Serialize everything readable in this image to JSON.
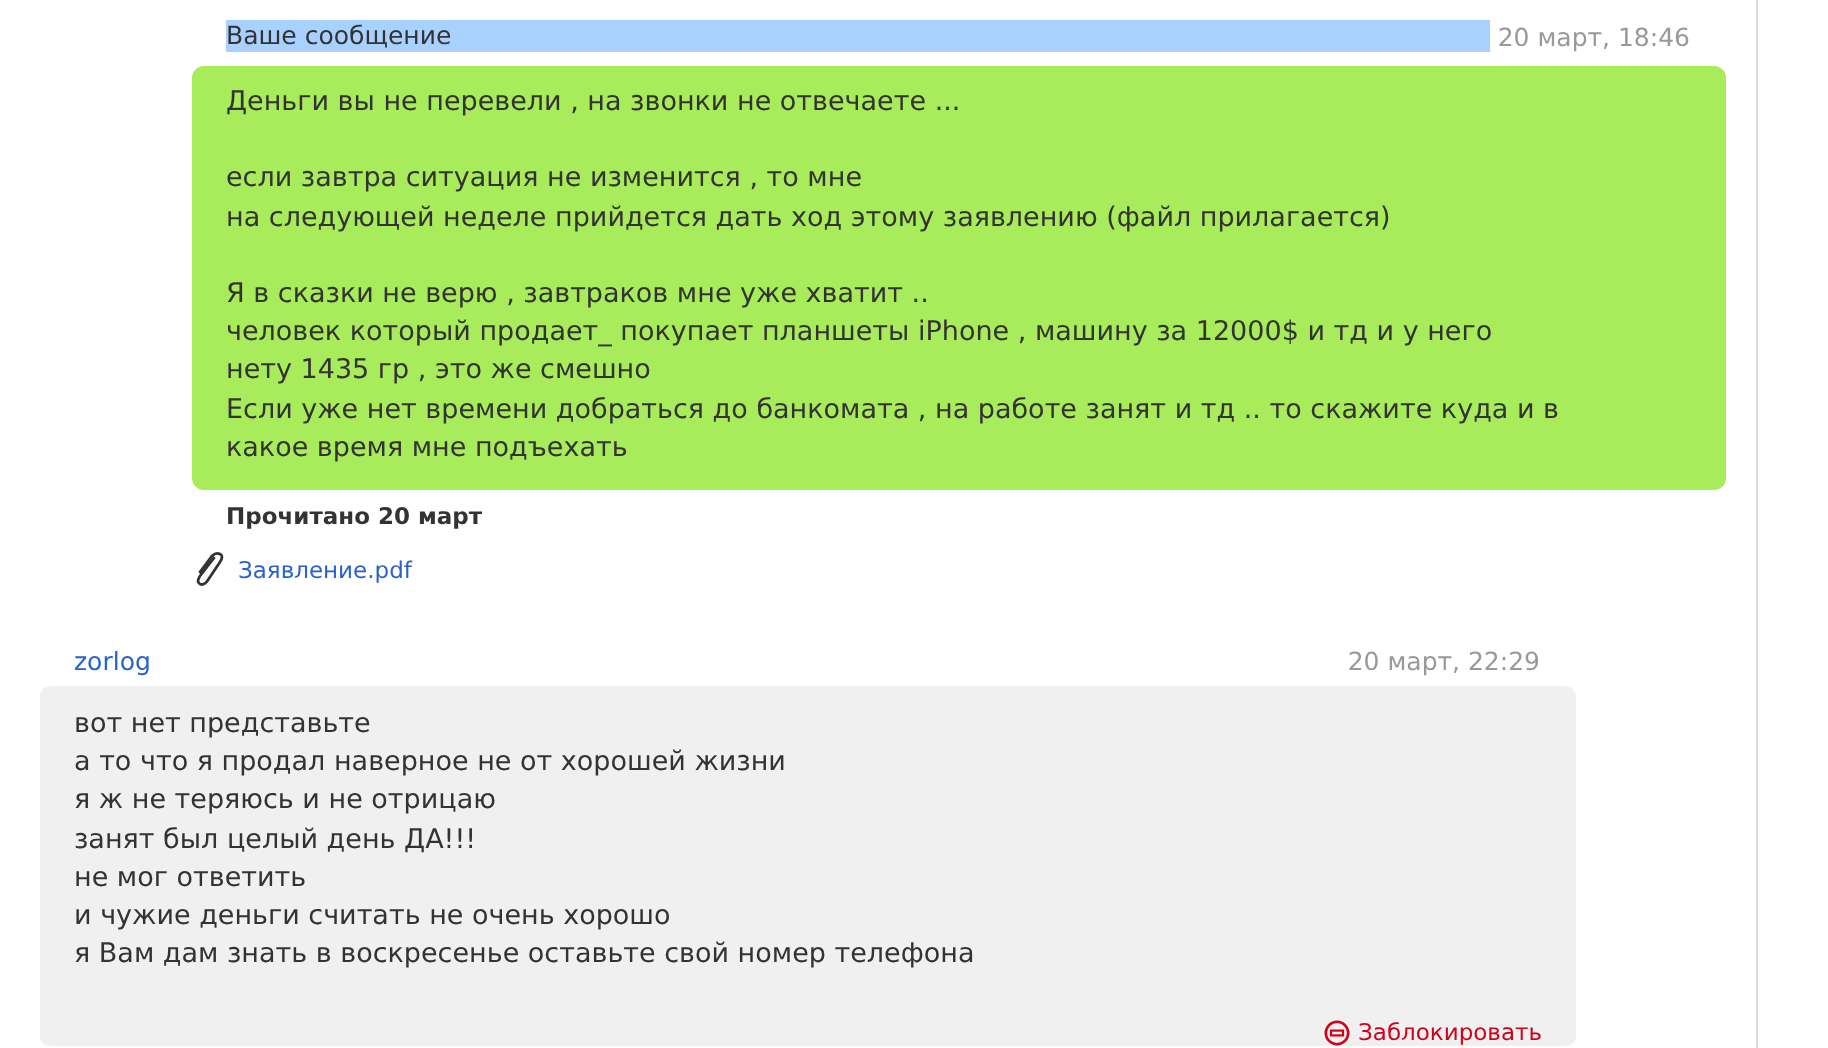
{
  "outgoing": {
    "header": "Ваше сообщение",
    "time": "20 март, 18:46",
    "paragraphs": [
      [
        "Деньги вы не перевели , на звонки не отвечаете ..."
      ],
      [
        "если завтра ситуация не изменится , то мне",
        "на следующей неделе прийдется дать ход этому заявлению (файл прилагается)"
      ],
      [
        "Я в сказки не верю , завтраков мне уже хватит ..",
        "человек который продает_ покупает планшеты iPhone , машину за 12000$ и тд и у него",
        "нету 1435 гр , это же смешно",
        "Если уже нет времени добраться до банкомата , на работе занят и тд .. то скажите куда и в",
        "какое время мне подъехать"
      ]
    ],
    "read_status": "Прочитано 20 март",
    "attachment": "Заявление.pdf"
  },
  "incoming": {
    "author": "zorlog",
    "time": "20 март, 22:29",
    "lines": [
      "вот нет представьте",
      "а то что я продал наверное не от хорошей жизни",
      "я ж не теряюсь и не отрицаю",
      "занят был целый день ДА!!!",
      "не мог ответить",
      "и чужие деньги считать не очень хорошо",
      "я Вам дам знать в воскресенье оставьте свой номер телефона"
    ],
    "block_link": "Заблокировать"
  }
}
